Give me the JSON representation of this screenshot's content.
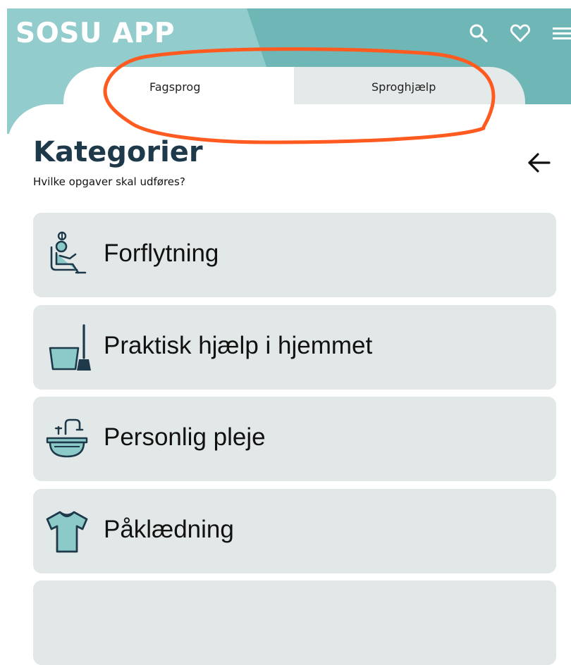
{
  "header": {
    "app_title": "SOSU APP",
    "icons": [
      "search-icon",
      "heart-icon",
      "menu-icon"
    ]
  },
  "tabs": [
    {
      "label": "Fagsprog",
      "selected": true
    },
    {
      "label": "Sproghjælp",
      "selected": false
    }
  ],
  "page": {
    "title": "Kategorier",
    "subtitle": "Hvilke opgaver skal udføres?"
  },
  "categories": [
    {
      "label": "Forflytning",
      "icon": "patient-lift-icon"
    },
    {
      "label": "Praktisk hjælp i hjemmet",
      "icon": "bucket-broom-icon"
    },
    {
      "label": "Personlig pleje",
      "icon": "sink-icon"
    },
    {
      "label": "Påklædning",
      "icon": "tshirt-icon"
    }
  ],
  "colors": {
    "header_teal": "#6fb6b6",
    "header_light": "#92cccc",
    "card_bg": "#e2e8e8",
    "title_dark": "#1e3a4a",
    "annotation_orange": "#ff5a1f"
  }
}
